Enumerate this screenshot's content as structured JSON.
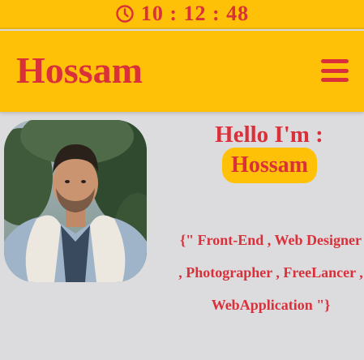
{
  "clock": {
    "icon": "clock-icon",
    "time": "10 : 12 : 48"
  },
  "navbar": {
    "brand": "Hossam",
    "menu_icon": "hamburger-menu-icon"
  },
  "hero": {
    "greeting": "Hello I'm :",
    "name": "Hossam",
    "roles_text": "{\" Front-End , Web Designer , Photographer , FreeLancer , WebApplication \"}"
  },
  "colors": {
    "accent": "#ffc107",
    "text": "#d9303a",
    "background": "#dcdcdf"
  }
}
